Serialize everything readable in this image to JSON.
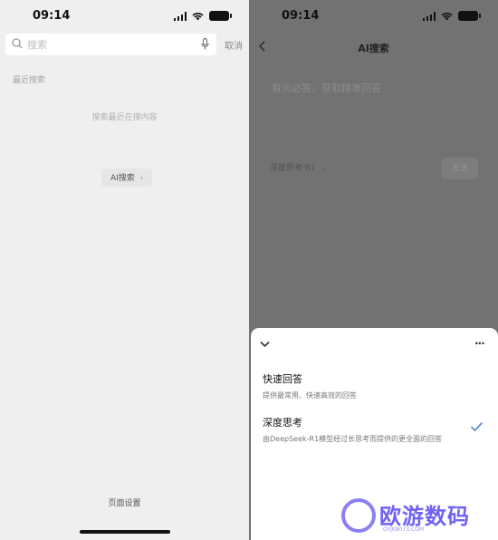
{
  "left": {
    "status_time": "09:14",
    "search": {
      "placeholder": "搜索"
    },
    "cancel_label": "取消",
    "recent_label": "最近搜索",
    "no_content_text": "搜索最近在搜内容",
    "ai_search_label": "AI搜索",
    "page_settings_label": "页面设置"
  },
  "right": {
    "status_time": "09:14",
    "title": "AI搜索",
    "input_placeholder": "有问必答，获取精准回答",
    "mode_label": "深度思考·R1",
    "send_label": "发送",
    "sheet": {
      "options": [
        {
          "title": "快速回答",
          "desc": "提供最常用、快速高效的回答",
          "selected": false
        },
        {
          "title": "深度思考",
          "desc": "由DeepSeek-R1模型经过长思考而提供的更全面的回答",
          "selected": true
        }
      ]
    }
  },
  "watermark": {
    "text": "欧游数码",
    "sub": "OYJK8073.COM"
  },
  "colors": {
    "accent_check": "#5b8fd6",
    "watermark": "#6f63f0",
    "dim_overlay": "#727272"
  }
}
